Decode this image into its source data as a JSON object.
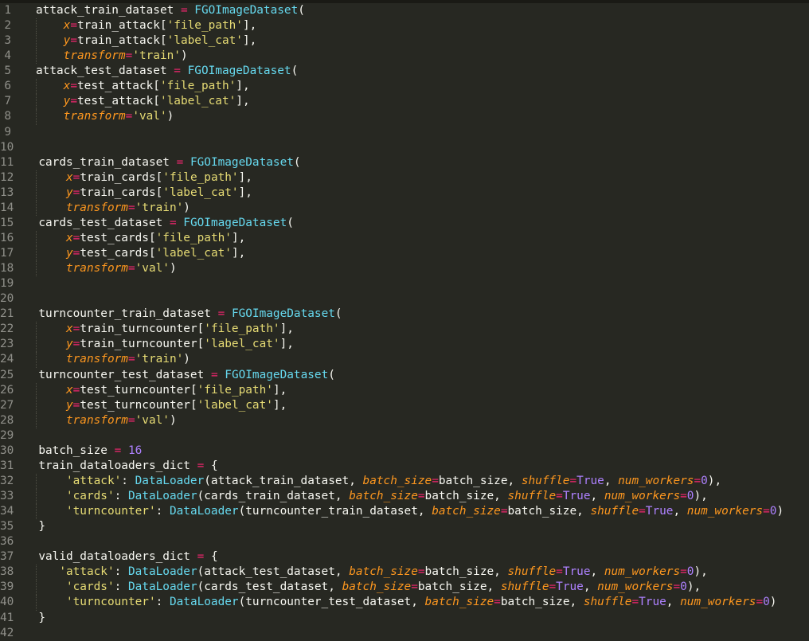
{
  "editor": {
    "theme": "monokai",
    "colors": {
      "background": "#272822",
      "top_strip": "#1a1a15",
      "text": "#f8f8f2",
      "operator": "#f92672",
      "class_name": "#66d9ef",
      "parameter": "#fd971f",
      "string": "#e6db74",
      "constant": "#ae81ff",
      "line_number": "#90908a",
      "indent_guide": "#4e4e44"
    },
    "lines": [
      {
        "num": 1,
        "guide": false,
        "tokens": [
          [
            "t",
            "attack_train_dataset "
          ],
          [
            "op",
            "="
          ],
          [
            "t",
            " "
          ],
          [
            "cls",
            "FGOImageDataset"
          ],
          [
            "t",
            "("
          ]
        ]
      },
      {
        "num": 2,
        "guide": true,
        "tokens": [
          [
            "t",
            "    "
          ],
          [
            "kw",
            "x"
          ],
          [
            "op",
            "="
          ],
          [
            "t",
            "train_attack["
          ],
          [
            "str",
            "'file_path'"
          ],
          [
            "t",
            "],"
          ]
        ]
      },
      {
        "num": 3,
        "guide": true,
        "tokens": [
          [
            "t",
            "    "
          ],
          [
            "kw",
            "y"
          ],
          [
            "op",
            "="
          ],
          [
            "t",
            "train_attack["
          ],
          [
            "str",
            "'label_cat'"
          ],
          [
            "t",
            "],"
          ]
        ]
      },
      {
        "num": 4,
        "guide": true,
        "tokens": [
          [
            "t",
            "    "
          ],
          [
            "kw",
            "transform"
          ],
          [
            "op",
            "="
          ],
          [
            "str",
            "'train'"
          ],
          [
            "t",
            ")"
          ]
        ]
      },
      {
        "num": 5,
        "guide": false,
        "tokens": [
          [
            "t",
            "attack_test_dataset "
          ],
          [
            "op",
            "="
          ],
          [
            "t",
            " "
          ],
          [
            "cls",
            "FGOImageDataset"
          ],
          [
            "t",
            "("
          ]
        ]
      },
      {
        "num": 6,
        "guide": true,
        "tokens": [
          [
            "t",
            "    "
          ],
          [
            "kw",
            "x"
          ],
          [
            "op",
            "="
          ],
          [
            "t",
            "test_attack["
          ],
          [
            "str",
            "'file_path'"
          ],
          [
            "t",
            "],"
          ]
        ]
      },
      {
        "num": 7,
        "guide": true,
        "tokens": [
          [
            "t",
            "    "
          ],
          [
            "kw",
            "y"
          ],
          [
            "op",
            "="
          ],
          [
            "t",
            "test_attack["
          ],
          [
            "str",
            "'label_cat'"
          ],
          [
            "t",
            "],"
          ]
        ]
      },
      {
        "num": 8,
        "guide": true,
        "tokens": [
          [
            "t",
            "    "
          ],
          [
            "kw",
            "transform"
          ],
          [
            "op",
            "="
          ],
          [
            "str",
            "'val'"
          ],
          [
            "t",
            ")"
          ]
        ]
      },
      {
        "num": 9,
        "guide": false,
        "tokens": []
      },
      {
        "num": 10,
        "guide": false,
        "tokens": []
      },
      {
        "num": 11,
        "guide": false,
        "tokens": [
          [
            "t",
            "cards_train_dataset "
          ],
          [
            "op",
            "="
          ],
          [
            "t",
            " "
          ],
          [
            "cls",
            "FGOImageDataset"
          ],
          [
            "t",
            "("
          ]
        ]
      },
      {
        "num": 12,
        "guide": true,
        "tokens": [
          [
            "t",
            "    "
          ],
          [
            "kw",
            "x"
          ],
          [
            "op",
            "="
          ],
          [
            "t",
            "train_cards["
          ],
          [
            "str",
            "'file_path'"
          ],
          [
            "t",
            "],"
          ]
        ]
      },
      {
        "num": 13,
        "guide": true,
        "tokens": [
          [
            "t",
            "    "
          ],
          [
            "kw",
            "y"
          ],
          [
            "op",
            "="
          ],
          [
            "t",
            "train_cards["
          ],
          [
            "str",
            "'label_cat'"
          ],
          [
            "t",
            "],"
          ]
        ]
      },
      {
        "num": 14,
        "guide": true,
        "tokens": [
          [
            "t",
            "    "
          ],
          [
            "kw",
            "transform"
          ],
          [
            "op",
            "="
          ],
          [
            "str",
            "'train'"
          ],
          [
            "t",
            ")"
          ]
        ]
      },
      {
        "num": 15,
        "guide": false,
        "tokens": [
          [
            "t",
            "cards_test_dataset "
          ],
          [
            "op",
            "="
          ],
          [
            "t",
            " "
          ],
          [
            "cls",
            "FGOImageDataset"
          ],
          [
            "t",
            "("
          ]
        ]
      },
      {
        "num": 16,
        "guide": true,
        "tokens": [
          [
            "t",
            "    "
          ],
          [
            "kw",
            "x"
          ],
          [
            "op",
            "="
          ],
          [
            "t",
            "test_cards["
          ],
          [
            "str",
            "'file_path'"
          ],
          [
            "t",
            "],"
          ]
        ]
      },
      {
        "num": 17,
        "guide": true,
        "tokens": [
          [
            "t",
            "    "
          ],
          [
            "kw",
            "y"
          ],
          [
            "op",
            "="
          ],
          [
            "t",
            "test_cards["
          ],
          [
            "str",
            "'label_cat'"
          ],
          [
            "t",
            "],"
          ]
        ]
      },
      {
        "num": 18,
        "guide": true,
        "tokens": [
          [
            "t",
            "    "
          ],
          [
            "kw",
            "transform"
          ],
          [
            "op",
            "="
          ],
          [
            "str",
            "'val'"
          ],
          [
            "t",
            ")"
          ]
        ]
      },
      {
        "num": 19,
        "guide": false,
        "tokens": []
      },
      {
        "num": 20,
        "guide": false,
        "tokens": []
      },
      {
        "num": 21,
        "guide": false,
        "tokens": [
          [
            "t",
            "turncounter_train_dataset "
          ],
          [
            "op",
            "="
          ],
          [
            "t",
            " "
          ],
          [
            "cls",
            "FGOImageDataset"
          ],
          [
            "t",
            "("
          ]
        ]
      },
      {
        "num": 22,
        "guide": true,
        "tokens": [
          [
            "t",
            "    "
          ],
          [
            "kw",
            "x"
          ],
          [
            "op",
            "="
          ],
          [
            "t",
            "train_turncounter["
          ],
          [
            "str",
            "'file_path'"
          ],
          [
            "t",
            "],"
          ]
        ]
      },
      {
        "num": 23,
        "guide": true,
        "tokens": [
          [
            "t",
            "    "
          ],
          [
            "kw",
            "y"
          ],
          [
            "op",
            "="
          ],
          [
            "t",
            "train_turncounter["
          ],
          [
            "str",
            "'label_cat'"
          ],
          [
            "t",
            "],"
          ]
        ]
      },
      {
        "num": 24,
        "guide": true,
        "tokens": [
          [
            "t",
            "    "
          ],
          [
            "kw",
            "transform"
          ],
          [
            "op",
            "="
          ],
          [
            "str",
            "'train'"
          ],
          [
            "t",
            ")"
          ]
        ]
      },
      {
        "num": 25,
        "guide": false,
        "tokens": [
          [
            "t",
            "turncounter_test_dataset "
          ],
          [
            "op",
            "="
          ],
          [
            "t",
            " "
          ],
          [
            "cls",
            "FGOImageDataset"
          ],
          [
            "t",
            "("
          ]
        ]
      },
      {
        "num": 26,
        "guide": true,
        "tokens": [
          [
            "t",
            "    "
          ],
          [
            "kw",
            "x"
          ],
          [
            "op",
            "="
          ],
          [
            "t",
            "test_turncounter["
          ],
          [
            "str",
            "'file_path'"
          ],
          [
            "t",
            "],"
          ]
        ]
      },
      {
        "num": 27,
        "guide": true,
        "tokens": [
          [
            "t",
            "    "
          ],
          [
            "kw",
            "y"
          ],
          [
            "op",
            "="
          ],
          [
            "t",
            "test_turncounter["
          ],
          [
            "str",
            "'label_cat'"
          ],
          [
            "t",
            "],"
          ]
        ]
      },
      {
        "num": 28,
        "guide": true,
        "tokens": [
          [
            "t",
            "    "
          ],
          [
            "kw",
            "transform"
          ],
          [
            "op",
            "="
          ],
          [
            "str",
            "'val'"
          ],
          [
            "t",
            ")"
          ]
        ]
      },
      {
        "num": 29,
        "guide": false,
        "tokens": []
      },
      {
        "num": 30,
        "guide": false,
        "tokens": [
          [
            "t",
            "batch_size "
          ],
          [
            "op",
            "="
          ],
          [
            "t",
            " "
          ],
          [
            "num",
            "16"
          ]
        ]
      },
      {
        "num": 31,
        "guide": false,
        "tokens": [
          [
            "t",
            "train_dataloaders_dict "
          ],
          [
            "op",
            "="
          ],
          [
            "t",
            " {"
          ]
        ]
      },
      {
        "num": 32,
        "guide": true,
        "tokens": [
          [
            "t",
            "    "
          ],
          [
            "str",
            "'attack'"
          ],
          [
            "t",
            ": "
          ],
          [
            "cls",
            "DataLoader"
          ],
          [
            "t",
            "(attack_train_dataset, "
          ],
          [
            "kw",
            "batch_size"
          ],
          [
            "op",
            "="
          ],
          [
            "t",
            "batch_size, "
          ],
          [
            "kw",
            "shuffle"
          ],
          [
            "op",
            "="
          ],
          [
            "num",
            "True"
          ],
          [
            "t",
            ", "
          ],
          [
            "kw",
            "num_workers"
          ],
          [
            "op",
            "="
          ],
          [
            "num",
            "0"
          ],
          [
            "t",
            "),"
          ]
        ]
      },
      {
        "num": 33,
        "guide": true,
        "tokens": [
          [
            "t",
            "    "
          ],
          [
            "str",
            "'cards'"
          ],
          [
            "t",
            ": "
          ],
          [
            "cls",
            "DataLoader"
          ],
          [
            "t",
            "(cards_train_dataset, "
          ],
          [
            "kw",
            "batch_size"
          ],
          [
            "op",
            "="
          ],
          [
            "t",
            "batch_size, "
          ],
          [
            "kw",
            "shuffle"
          ],
          [
            "op",
            "="
          ],
          [
            "num",
            "True"
          ],
          [
            "t",
            ", "
          ],
          [
            "kw",
            "num_workers"
          ],
          [
            "op",
            "="
          ],
          [
            "num",
            "0"
          ],
          [
            "t",
            "),"
          ]
        ]
      },
      {
        "num": 34,
        "guide": true,
        "tokens": [
          [
            "t",
            "    "
          ],
          [
            "str",
            "'turncounter'"
          ],
          [
            "t",
            ": "
          ],
          [
            "cls",
            "DataLoader"
          ],
          [
            "t",
            "(turncounter_train_dataset, "
          ],
          [
            "kw",
            "batch_size"
          ],
          [
            "op",
            "="
          ],
          [
            "t",
            "batch_size, "
          ],
          [
            "kw",
            "shuffle"
          ],
          [
            "op",
            "="
          ],
          [
            "num",
            "True"
          ],
          [
            "t",
            ", "
          ],
          [
            "kw",
            "num_workers"
          ],
          [
            "op",
            "="
          ],
          [
            "num",
            "0"
          ],
          [
            "t",
            ")"
          ]
        ]
      },
      {
        "num": 35,
        "guide": false,
        "tokens": [
          [
            "t",
            "}"
          ]
        ]
      },
      {
        "num": 36,
        "guide": false,
        "tokens": []
      },
      {
        "num": 37,
        "guide": false,
        "tokens": [
          [
            "t",
            "valid_dataloaders_dict "
          ],
          [
            "op",
            "="
          ],
          [
            "t",
            " {"
          ]
        ]
      },
      {
        "num": 38,
        "guide": true,
        "tokens": [
          [
            "t",
            "   "
          ],
          [
            "str",
            "'attack'"
          ],
          [
            "t",
            ": "
          ],
          [
            "cls",
            "DataLoader"
          ],
          [
            "t",
            "(attack_test_dataset, "
          ],
          [
            "kw",
            "batch_size"
          ],
          [
            "op",
            "="
          ],
          [
            "t",
            "batch_size, "
          ],
          [
            "kw",
            "shuffle"
          ],
          [
            "op",
            "="
          ],
          [
            "num",
            "True"
          ],
          [
            "t",
            ", "
          ],
          [
            "kw",
            "num_workers"
          ],
          [
            "op",
            "="
          ],
          [
            "num",
            "0"
          ],
          [
            "t",
            "),"
          ]
        ]
      },
      {
        "num": 39,
        "guide": true,
        "tokens": [
          [
            "t",
            "    "
          ],
          [
            "str",
            "'cards'"
          ],
          [
            "t",
            ": "
          ],
          [
            "cls",
            "DataLoader"
          ],
          [
            "t",
            "(cards_test_dataset, "
          ],
          [
            "kw",
            "batch_size"
          ],
          [
            "op",
            "="
          ],
          [
            "t",
            "batch_size, "
          ],
          [
            "kw",
            "shuffle"
          ],
          [
            "op",
            "="
          ],
          [
            "num",
            "True"
          ],
          [
            "t",
            ", "
          ],
          [
            "kw",
            "num_workers"
          ],
          [
            "op",
            "="
          ],
          [
            "num",
            "0"
          ],
          [
            "t",
            "),"
          ]
        ]
      },
      {
        "num": 40,
        "guide": true,
        "tokens": [
          [
            "t",
            "    "
          ],
          [
            "str",
            "'turncounter'"
          ],
          [
            "t",
            ": "
          ],
          [
            "cls",
            "DataLoader"
          ],
          [
            "t",
            "(turncounter_test_dataset, "
          ],
          [
            "kw",
            "batch_size"
          ],
          [
            "op",
            "="
          ],
          [
            "t",
            "batch_size, "
          ],
          [
            "kw",
            "shuffle"
          ],
          [
            "op",
            "="
          ],
          [
            "num",
            "True"
          ],
          [
            "t",
            ", "
          ],
          [
            "kw",
            "num_workers"
          ],
          [
            "op",
            "="
          ],
          [
            "num",
            "0"
          ],
          [
            "t",
            ")"
          ]
        ]
      },
      {
        "num": 41,
        "guide": false,
        "tokens": [
          [
            "t",
            "}"
          ]
        ]
      },
      {
        "num": 42,
        "guide": false,
        "tokens": []
      }
    ]
  }
}
